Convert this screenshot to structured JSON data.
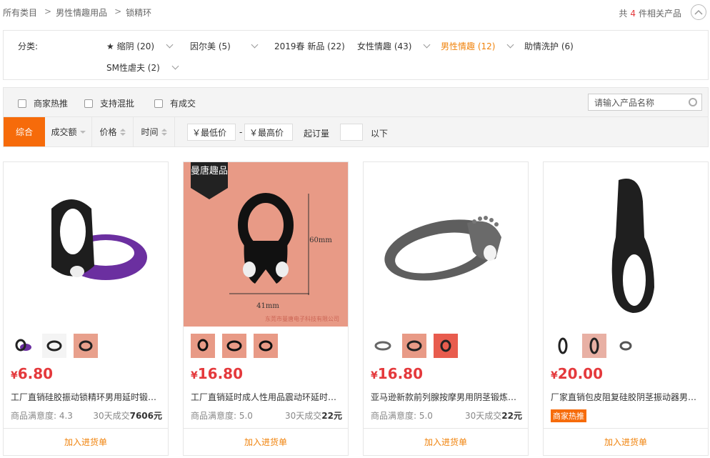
{
  "breadcrumb": {
    "items": [
      "所有类目",
      "男性情趣用品",
      "锁精环"
    ]
  },
  "result_count": {
    "prefix": "共",
    "number": "4",
    "suffix": "件相关产品"
  },
  "category": {
    "label": "分类:",
    "items": [
      {
        "label": "★ 缩阴 (20)"
      },
      {
        "label": "因尔美 (5)"
      },
      {
        "label": "2019春 新品 (22)"
      },
      {
        "label": "女性情趣 (43)"
      },
      {
        "label": "男性情趣 (12)",
        "active": true
      },
      {
        "label": "助情洗护 (6)"
      },
      {
        "label": "SM性虐夫 (2)"
      }
    ]
  },
  "filters": {
    "checkboxes": [
      "商家热推",
      "支持混批",
      "有成交"
    ],
    "search_placeholder": "请输入产品名称",
    "sorts": [
      "综合",
      "成交额",
      "价格",
      "时间"
    ],
    "min_price": "￥最低价",
    "dash": "-",
    "max_price": "￥最高价",
    "moq_label": "起订量",
    "moq_suffix": "以下"
  },
  "products": [
    {
      "price": "6.80",
      "currency": "¥",
      "title": "工厂直销硅胶振动锁精环男用延时锻炼...",
      "satisfaction_label": "商品满意度: 4.3",
      "sales_label": "30天成交",
      "sales_value": "7606元",
      "add_label": "加入进货单"
    },
    {
      "price": "16.80",
      "currency": "¥",
      "title": "工厂直销延时成人性用品震动环延时锻...",
      "satisfaction_label": "商品满意度: 5.0",
      "sales_label": "30天成交",
      "sales_value": "22元",
      "add_label": "加入进货单",
      "image_text": {
        "brand": "曼唐趣品",
        "dim_v": "60mm",
        "dim_h": "41mm",
        "footer": "东莞市曼唐电子科技有限公司"
      }
    },
    {
      "price": "16.80",
      "currency": "¥",
      "title": "亚马逊新款前列腺按摩男用阴茎锻炼器...",
      "satisfaction_label": "商品满意度: 5.0",
      "sales_label": "30天成交",
      "sales_value": "22元",
      "add_label": "加入进货单"
    },
    {
      "price": "20.00",
      "currency": "¥",
      "title": "厂家直销包皮阻复硅胶阴茎振动器男用...",
      "badge": "商家热推",
      "add_label": "加入进货单"
    }
  ],
  "colors": {
    "accent": "#f66b0a",
    "price": "#e4393c"
  }
}
